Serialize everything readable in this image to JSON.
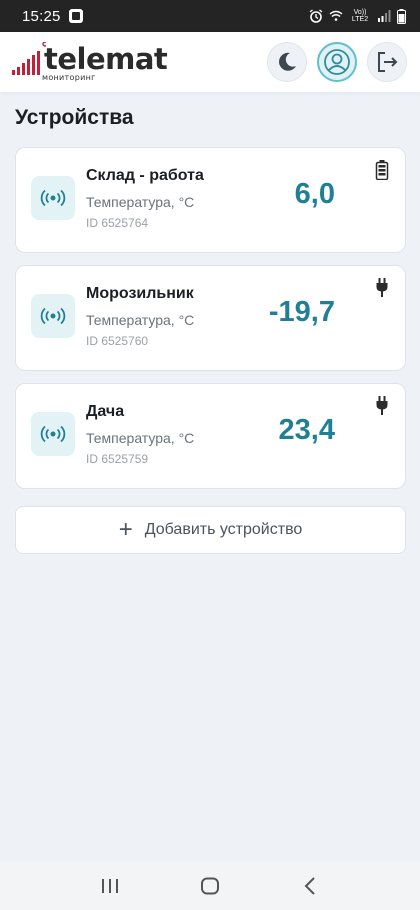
{
  "status_bar": {
    "time": "15:25",
    "network_label": "Vo)) LTE2"
  },
  "header": {
    "logo_text": "telemat",
    "logo_subtext": "мониторинг",
    "buttons": [
      "moon-icon",
      "user-icon",
      "logout-icon"
    ]
  },
  "page": {
    "title": "Устройства"
  },
  "devices": [
    {
      "name": "Склад - работа",
      "metric": "Температура, °C",
      "id": "ID 6525764",
      "value": "6,0",
      "power": "battery-icon"
    },
    {
      "name": "Морозильник",
      "metric": "Температура, °C",
      "id": "ID 6525760",
      "value": "-19,7",
      "power": "plug-icon"
    },
    {
      "name": "Дача",
      "metric": "Температура, °C",
      "id": "ID 6525759",
      "value": "23,4",
      "power": "plug-icon"
    }
  ],
  "add_button": {
    "label": "Добавить устройство"
  },
  "colors": {
    "accent": "#1f7f95",
    "icon_bg": "#e3f3f5",
    "page_bg": "#eef2f7"
  }
}
